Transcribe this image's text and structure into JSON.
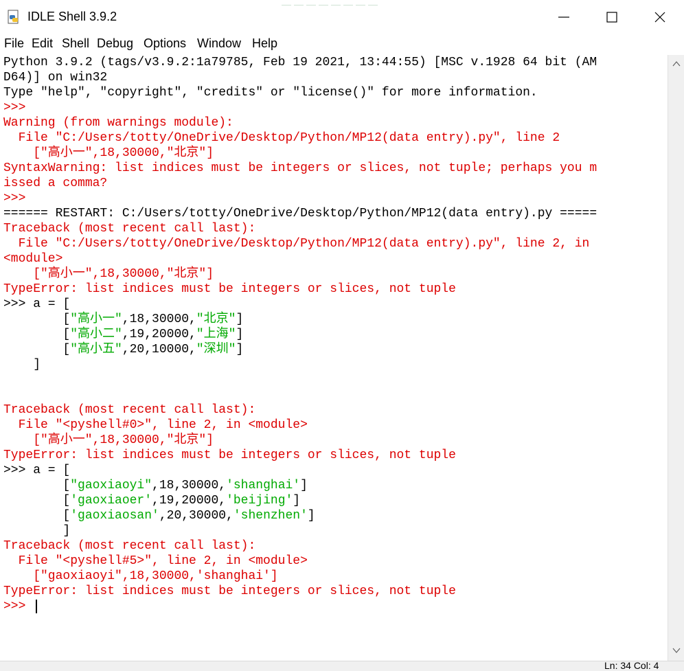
{
  "window": {
    "title": "IDLE Shell 3.9.2",
    "icon": "python-idle-icon",
    "controls": [
      "minimize-icon",
      "maximize-icon",
      "close-icon"
    ]
  },
  "menu": [
    "File",
    "Edit",
    "Shell",
    "Debug",
    "Options",
    "Window",
    "Help"
  ],
  "shell": {
    "lines": [
      [
        {
          "t": "Python 3.9.2 (tags/v3.9.2:1a79785, Feb 19 2021, 13:44:55) [MSC v.1928 64 bit (AM",
          "c": "black"
        }
      ],
      [
        {
          "t": "D64)] on win32",
          "c": "black"
        }
      ],
      [
        {
          "t": "Type \"help\", \"copyright\", \"credits\" or \"license()\" for more information.",
          "c": "black"
        }
      ],
      [
        {
          "t": ">>>",
          "c": "red"
        }
      ],
      [
        {
          "t": "Warning (from warnings module):",
          "c": "red"
        }
      ],
      [
        {
          "t": "  File \"C:/Users/totty/OneDrive/Desktop/Python/MP12(data entry).py\", line 2",
          "c": "red"
        }
      ],
      [
        {
          "t": "    [\"高小一\",18,30000,\"北京\"]",
          "c": "red"
        }
      ],
      [
        {
          "t": "SyntaxWarning: list indices must be integers or slices, not tuple; perhaps you m",
          "c": "red"
        }
      ],
      [
        {
          "t": "issed a comma?",
          "c": "red"
        }
      ],
      [
        {
          "t": ">>>",
          "c": "red"
        }
      ],
      [
        {
          "t": "====== RESTART: C:/Users/totty/OneDrive/Desktop/Python/MP12(data entry).py =====",
          "c": "black"
        }
      ],
      [
        {
          "t": "Traceback (most recent call last):",
          "c": "red"
        }
      ],
      [
        {
          "t": "  File \"C:/Users/totty/OneDrive/Desktop/Python/MP12(data entry).py\", line 2, in",
          "c": "red"
        }
      ],
      [
        {
          "t": "<module>",
          "c": "red"
        }
      ],
      [
        {
          "t": "    [\"高小一\",18,30000,\"北京\"]",
          "c": "red"
        }
      ],
      [
        {
          "t": "TypeError: list indices must be integers or slices, not tuple",
          "c": "red"
        }
      ],
      [
        {
          "t": ">>> a = [",
          "c": "black"
        }
      ],
      [
        {
          "t": "        [",
          "c": "black"
        },
        {
          "t": "\"高小一\"",
          "c": "green"
        },
        {
          "t": ",18,30000,",
          "c": "black"
        },
        {
          "t": "\"北京\"",
          "c": "green"
        },
        {
          "t": "]",
          "c": "black"
        }
      ],
      [
        {
          "t": "        [",
          "c": "black"
        },
        {
          "t": "\"高小二\"",
          "c": "green"
        },
        {
          "t": ",19,20000,",
          "c": "black"
        },
        {
          "t": "\"上海\"",
          "c": "green"
        },
        {
          "t": "]",
          "c": "black"
        }
      ],
      [
        {
          "t": "        [",
          "c": "black"
        },
        {
          "t": "\"高小五\"",
          "c": "green"
        },
        {
          "t": ",20,10000,",
          "c": "black"
        },
        {
          "t": "\"深圳\"",
          "c": "green"
        },
        {
          "t": "]",
          "c": "black"
        }
      ],
      [
        {
          "t": "    ]",
          "c": "black"
        }
      ],
      [
        {
          "t": "",
          "c": "black"
        }
      ],
      [
        {
          "t": "",
          "c": "black"
        }
      ],
      [
        {
          "t": "Traceback (most recent call last):",
          "c": "red"
        }
      ],
      [
        {
          "t": "  File \"<pyshell#0>\", line 2, in <module>",
          "c": "red"
        }
      ],
      [
        {
          "t": "    [\"高小一\",18,30000,\"北京\"]",
          "c": "red"
        }
      ],
      [
        {
          "t": "TypeError: list indices must be integers or slices, not tuple",
          "c": "red"
        }
      ],
      [
        {
          "t": ">>> a = [",
          "c": "black"
        }
      ],
      [
        {
          "t": "        [",
          "c": "black"
        },
        {
          "t": "\"gaoxiaoyi\"",
          "c": "green"
        },
        {
          "t": ",18,30000,",
          "c": "black"
        },
        {
          "t": "'shanghai'",
          "c": "green"
        },
        {
          "t": "]",
          "c": "black"
        }
      ],
      [
        {
          "t": "        [",
          "c": "black"
        },
        {
          "t": "'gaoxiaoer'",
          "c": "green"
        },
        {
          "t": ",19,20000,",
          "c": "black"
        },
        {
          "t": "'beijing'",
          "c": "green"
        },
        {
          "t": "]",
          "c": "black"
        }
      ],
      [
        {
          "t": "        [",
          "c": "black"
        },
        {
          "t": "'gaoxiaosan'",
          "c": "green"
        },
        {
          "t": ",20,30000,",
          "c": "black"
        },
        {
          "t": "'shenzhen'",
          "c": "green"
        },
        {
          "t": "]",
          "c": "black"
        }
      ],
      [
        {
          "t": "        ]",
          "c": "black"
        }
      ],
      [
        {
          "t": "Traceback (most recent call last):",
          "c": "red"
        }
      ],
      [
        {
          "t": "  File \"<pyshell#5>\", line 2, in <module>",
          "c": "red"
        }
      ],
      [
        {
          "t": "    [\"gaoxiaoyi\",18,30000,'shanghai']",
          "c": "red"
        }
      ],
      [
        {
          "t": "TypeError: list indices must be integers or slices, not tuple",
          "c": "red"
        }
      ],
      [
        {
          "t": ">>> ",
          "c": "red"
        }
      ]
    ]
  },
  "status": "Ln: 34  Col: 4",
  "colors": {
    "black": "#000000",
    "red": "#dd0000",
    "green": "#00aa00"
  }
}
